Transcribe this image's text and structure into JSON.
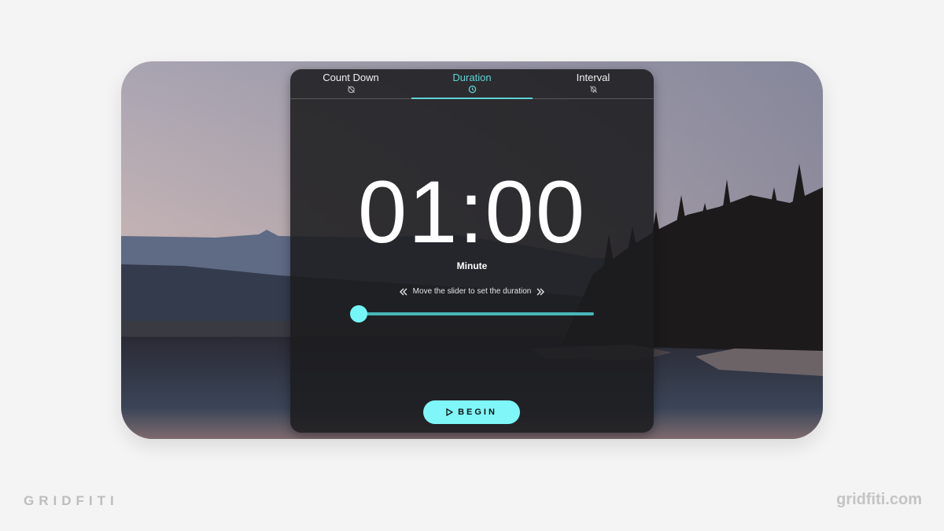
{
  "timer": {
    "tabs": [
      {
        "label": "Count Down",
        "icon": "timer-off-icon",
        "active": false
      },
      {
        "label": "Duration",
        "icon": "clock-icon",
        "active": true
      },
      {
        "label": "Interval",
        "icon": "bell-off-icon",
        "active": false
      }
    ],
    "time_display": "01:00",
    "unit_label": "Minute",
    "slider_hint": "Move the slider to set the duration",
    "slider_value_fraction": 0,
    "begin_label": "BEGIN",
    "accent_color": "#5fd3d6",
    "button_color": "#7ff7f9"
  },
  "branding": {
    "left_logo": "GRIDFITI",
    "right_url": "gridfiti.com"
  }
}
